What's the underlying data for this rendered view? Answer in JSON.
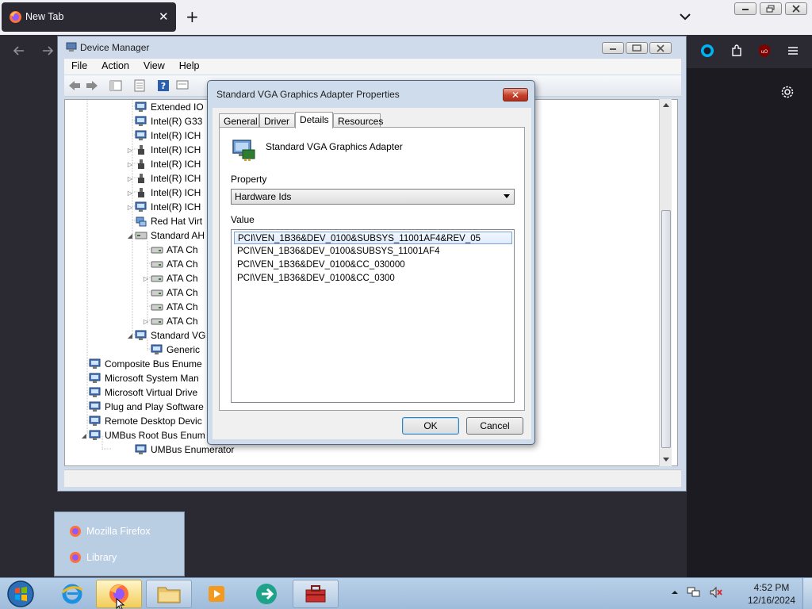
{
  "browser": {
    "tab_title": "New Tab",
    "close_tab_glyph": "✕",
    "new_tab_glyph": "+",
    "accent": "#2b2a33"
  },
  "device_manager": {
    "title": "Device Manager",
    "menu": [
      "File",
      "Action",
      "View",
      "Help"
    ],
    "tree": [
      {
        "label": "Extended IO",
        "level": 2,
        "expander": "",
        "icon": "monitor-icon"
      },
      {
        "label": "Intel(R) G33",
        "level": 2,
        "expander": "",
        "icon": "monitor-icon"
      },
      {
        "label": "Intel(R) ICH",
        "level": 2,
        "expander": "",
        "icon": "monitor-icon"
      },
      {
        "label": "Intel(R) ICH",
        "level": 2,
        "expander": "▷",
        "icon": "usb-icon"
      },
      {
        "label": "Intel(R) ICH",
        "level": 2,
        "expander": "▷",
        "icon": "usb-icon"
      },
      {
        "label": "Intel(R) ICH",
        "level": 2,
        "expander": "▷",
        "icon": "usb-icon"
      },
      {
        "label": "Intel(R) ICH",
        "level": 2,
        "expander": "▷",
        "icon": "usb-icon"
      },
      {
        "label": "Intel(R) ICH",
        "level": 2,
        "expander": "▷",
        "icon": "monitor-icon"
      },
      {
        "label": "Red Hat Virt",
        "level": 2,
        "expander": "",
        "icon": "network-icon"
      },
      {
        "label": "Standard AH",
        "level": 2,
        "expander": "◢",
        "icon": "controller-icon"
      },
      {
        "label": "ATA Ch",
        "level": 3,
        "expander": "",
        "icon": "disk-icon"
      },
      {
        "label": "ATA Ch",
        "level": 3,
        "expander": "",
        "icon": "disk-icon"
      },
      {
        "label": "ATA Ch",
        "level": 3,
        "expander": "▷",
        "icon": "disk-icon"
      },
      {
        "label": "ATA Ch",
        "level": 3,
        "expander": "",
        "icon": "disk-icon"
      },
      {
        "label": "ATA Ch",
        "level": 3,
        "expander": "",
        "icon": "disk-icon"
      },
      {
        "label": "ATA Ch",
        "level": 3,
        "expander": "▷",
        "icon": "disk-icon"
      },
      {
        "label": "Standard VG",
        "level": 2,
        "expander": "◢",
        "icon": "monitor-icon"
      },
      {
        "label": "Generic",
        "level": 3,
        "expander": "",
        "icon": "monitor-icon"
      },
      {
        "label": "Composite Bus Enume",
        "level": 1,
        "expander": "",
        "icon": "monitor-icon"
      },
      {
        "label": "Microsoft System Man",
        "level": 1,
        "expander": "",
        "icon": "monitor-icon"
      },
      {
        "label": "Microsoft Virtual Drive",
        "level": 1,
        "expander": "",
        "icon": "monitor-icon"
      },
      {
        "label": "Plug and Play Software",
        "level": 1,
        "expander": "",
        "icon": "monitor-icon"
      },
      {
        "label": "Remote Desktop Devic",
        "level": 1,
        "expander": "",
        "icon": "monitor-icon"
      },
      {
        "label": "UMBus Root Bus Enum",
        "level": 1,
        "expander": "◢",
        "icon": "monitor-icon"
      },
      {
        "label": "UMBus Enumerator",
        "level": 2,
        "expander": "",
        "icon": "monitor-icon"
      }
    ]
  },
  "dialog": {
    "title": "Standard VGA Graphics Adapter Properties",
    "close_glyph": "✕",
    "tabs": [
      "General",
      "Driver",
      "Details",
      "Resources"
    ],
    "active_tab": "Details",
    "device_name": "Standard VGA Graphics Adapter",
    "property_label": "Property",
    "property_value": "Hardware Ids",
    "value_label": "Value",
    "values": [
      "PCI\\VEN_1B36&DEV_0100&SUBSYS_11001AF4&REV_05",
      "PCI\\VEN_1B36&DEV_0100&SUBSYS_11001AF4",
      "PCI\\VEN_1B36&DEV_0100&CC_030000",
      "PCI\\VEN_1B36&DEV_0100&CC_0300"
    ],
    "ok_label": "OK",
    "cancel_label": "Cancel"
  },
  "jumplist": {
    "items": [
      "Mozilla Firefox",
      "Library"
    ]
  },
  "taskbar": {
    "time": "4:52 PM",
    "date": "12/16/2024",
    "apps": [
      "internet-explorer-icon",
      "firefox-icon",
      "file-explorer-icon",
      "media-player-icon",
      "globe-arrow-icon",
      "toolbox-icon"
    ]
  }
}
